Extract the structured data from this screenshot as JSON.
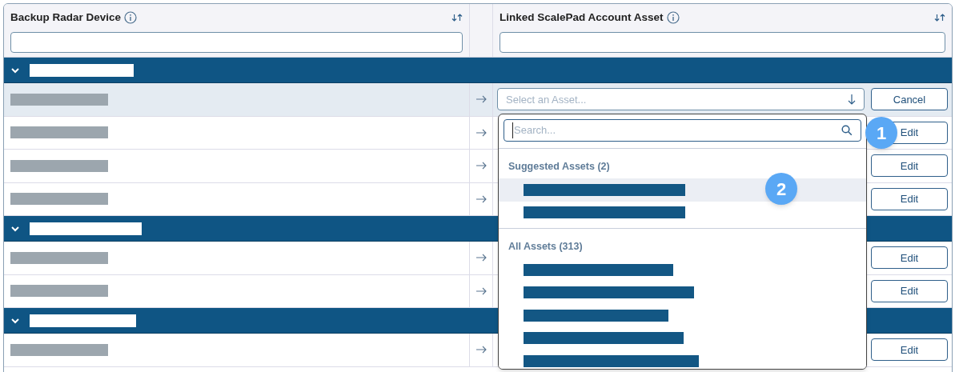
{
  "columns": [
    {
      "title": "Backup Radar Device"
    },
    {
      "title": "Linked ScalePad Account Asset"
    }
  ],
  "groups": [
    {
      "expanded": true,
      "rows": [
        {
          "selected": true,
          "action": "Cancel",
          "select_placeholder": "Select an Asset..."
        },
        {
          "selected": false,
          "action": "Edit"
        },
        {
          "selected": false,
          "action": "Edit"
        },
        {
          "selected": false,
          "action": "Edit"
        }
      ]
    },
    {
      "expanded": true,
      "rows": [
        {
          "selected": false,
          "action": "Edit"
        },
        {
          "selected": false,
          "action": "Edit"
        }
      ]
    },
    {
      "expanded": true,
      "rows": [
        {
          "selected": false,
          "action": "Edit"
        }
      ]
    }
  ],
  "dropdown": {
    "search_placeholder": "Search...",
    "sections": [
      {
        "title": "Suggested Assets (2)",
        "items": [
          {
            "selected": true
          },
          {
            "selected": false
          }
        ]
      },
      {
        "title": "All Assets (313)",
        "items": [
          {
            "selected": false
          },
          {
            "selected": false
          },
          {
            "selected": false
          },
          {
            "selected": false
          },
          {
            "selected": false
          }
        ]
      }
    ]
  },
  "annotations": [
    "1",
    "2"
  ]
}
